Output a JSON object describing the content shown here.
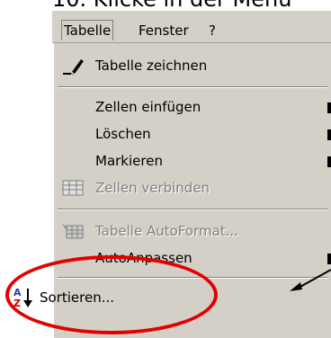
{
  "caption": "10. Klicke in der Menü",
  "menubar": {
    "items": [
      "Tabelle",
      "Fenster",
      "?"
    ]
  },
  "menu": {
    "items": [
      {
        "label": "Tabelle zeichnen",
        "icon": "pencil-icon",
        "enabled": true
      },
      {
        "label": "Zellen einfügen",
        "enabled": true,
        "submenu": true
      },
      {
        "label": "Löschen",
        "enabled": true,
        "submenu": true
      },
      {
        "label": "Markieren",
        "enabled": true,
        "submenu": true
      },
      {
        "label": "Zellen verbinden",
        "icon": "merge-cells-icon",
        "enabled": false
      },
      {
        "label": "Tabelle AutoFormat...",
        "icon": "autoformat-icon",
        "enabled": false
      },
      {
        "label": "AutoAnpassen",
        "enabled": true,
        "submenu": true
      },
      {
        "label": "Sortieren...",
        "icon": "sort-az-icon",
        "enabled": true
      }
    ]
  },
  "colors": {
    "annotation": "#e30000",
    "menu_bg": "#d4d0c8"
  }
}
